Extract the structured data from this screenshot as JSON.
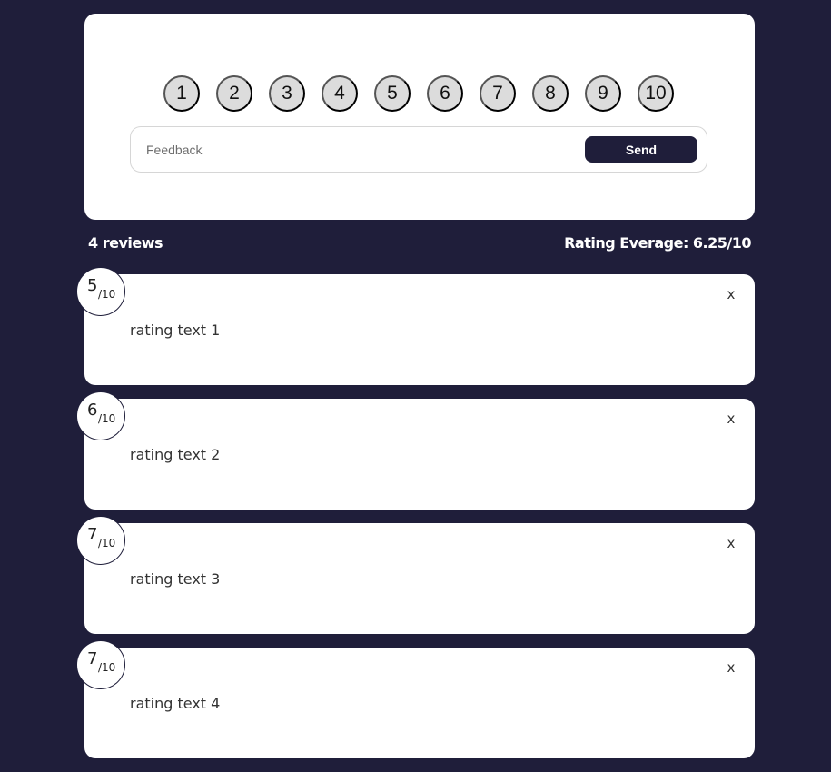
{
  "rating_form": {
    "options": [
      "1",
      "2",
      "3",
      "4",
      "5",
      "6",
      "7",
      "8",
      "9",
      "10"
    ],
    "feedback": {
      "placeholder": "Feedback",
      "value": ""
    },
    "send_label": "Send"
  },
  "stats": {
    "review_count": "4 reviews",
    "average": "Rating Everage: 6.25/10"
  },
  "reviews": [
    {
      "score": "5",
      "max": "/10",
      "text": "rating text 1",
      "close_label": "x"
    },
    {
      "score": "6",
      "max": "/10",
      "text": "rating text 2",
      "close_label": "x"
    },
    {
      "score": "7",
      "max": "/10",
      "text": "rating text 3",
      "close_label": "x"
    },
    {
      "score": "7",
      "max": "/10",
      "text": "rating text 4",
      "close_label": "x"
    }
  ],
  "colors": {
    "background": "#1f1e3a",
    "card": "#ffffff",
    "rating_option": "#dcdcdc",
    "accent": "#1f1e3a"
  }
}
